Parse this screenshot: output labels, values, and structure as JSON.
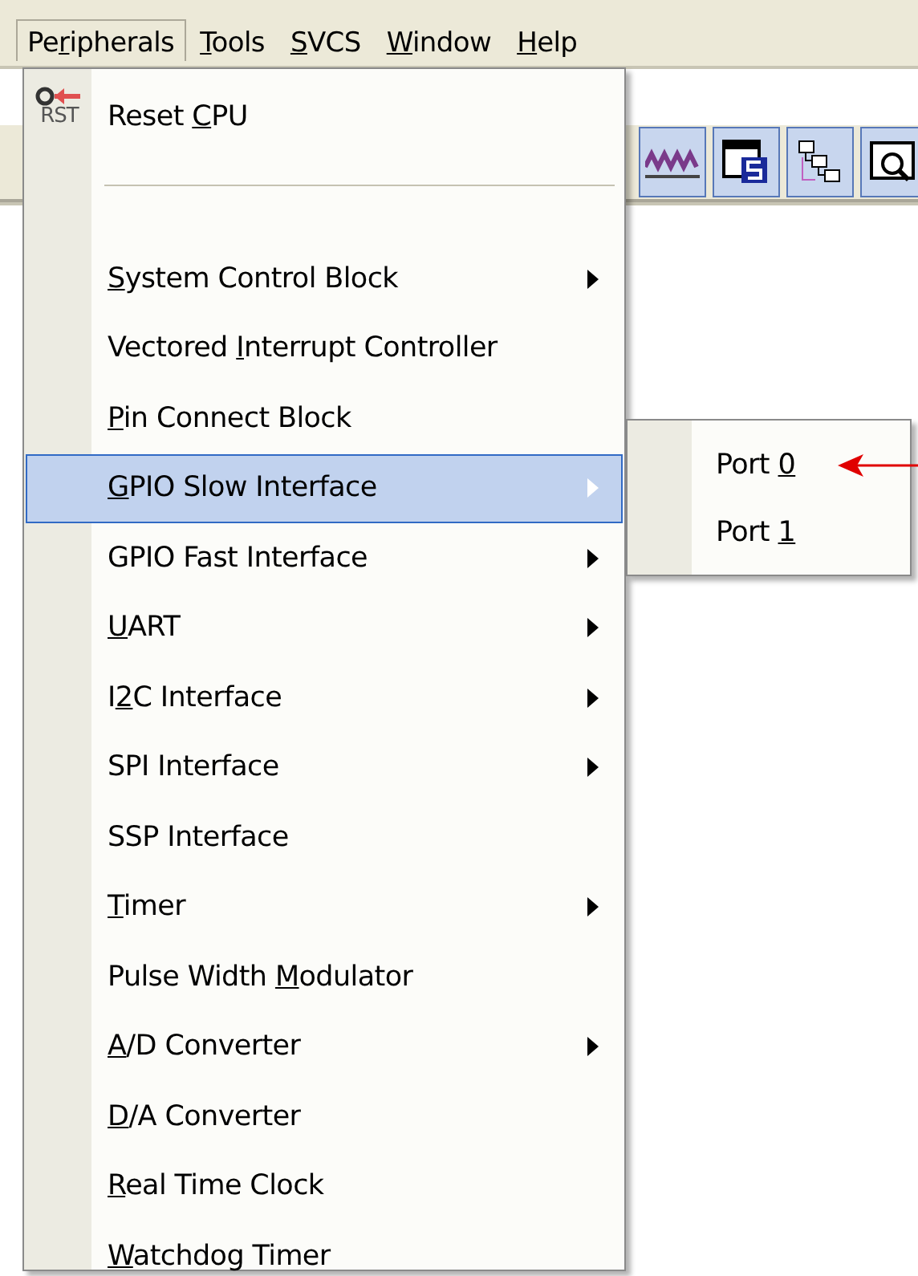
{
  "menubar": [
    {
      "label": {
        "before": "Pe",
        "key": "r",
        "after": "ipherals"
      },
      "selected": true
    },
    {
      "label": {
        "key": "T",
        "after": "ools"
      },
      "selected": false
    },
    {
      "label": {
        "key": "S",
        "after": "VCS"
      },
      "selected": false
    },
    {
      "label": {
        "key": "W",
        "after": "indow"
      },
      "selected": false
    },
    {
      "label": {
        "key": "H",
        "after": "elp"
      },
      "selected": false
    }
  ],
  "menu": {
    "items": [
      {
        "kind": "command",
        "label": {
          "before": "Reset ",
          "key": "C",
          "after": "PU"
        },
        "icon_text": "RST",
        "selected": false
      },
      {
        "kind": "separator"
      },
      {
        "kind": "submenu",
        "label": {
          "key": "S",
          "after": "ystem Control Block"
        },
        "selected": false
      },
      {
        "kind": "command",
        "label": {
          "before": "Vectored ",
          "key": "I",
          "after": "nterrupt Controller"
        },
        "selected": false
      },
      {
        "kind": "command",
        "label": {
          "key": "P",
          "after": "in Connect Block"
        },
        "selected": false
      },
      {
        "kind": "submenu",
        "label": {
          "key": "G",
          "after": "PIO Slow Interface"
        },
        "selected": true
      },
      {
        "kind": "submenu",
        "label": {
          "after": "GPIO Fast Interface"
        },
        "selected": false
      },
      {
        "kind": "submenu",
        "label": {
          "key": "U",
          "after": "ART"
        },
        "selected": false
      },
      {
        "kind": "submenu",
        "label": {
          "before": "I",
          "key": "2",
          "after": "C Interface"
        },
        "selected": false
      },
      {
        "kind": "submenu",
        "label": {
          "after": "SPI Interface"
        },
        "selected": false
      },
      {
        "kind": "command",
        "label": {
          "after": "SSP Interface"
        },
        "selected": false
      },
      {
        "kind": "submenu",
        "label": {
          "key": "T",
          "after": "imer"
        },
        "selected": false
      },
      {
        "kind": "command",
        "label": {
          "before": "Pulse Width ",
          "key": "M",
          "after": "odulator"
        },
        "selected": false
      },
      {
        "kind": "submenu",
        "label": {
          "key": "A",
          "after": "/D Converter"
        },
        "selected": false
      },
      {
        "kind": "command",
        "label": {
          "key": "D",
          "after": "/A Converter"
        },
        "selected": false
      },
      {
        "kind": "command",
        "label": {
          "key": "R",
          "after": "eal Time Clock"
        },
        "selected": false
      },
      {
        "kind": "command",
        "label": {
          "key": "W",
          "after": "atchdog Timer"
        },
        "selected": false
      }
    ]
  },
  "submenu": {
    "items": [
      {
        "label": {
          "before": "Port ",
          "key": "0"
        },
        "selected": false
      },
      {
        "label": {
          "before": "Port ",
          "key": "1"
        },
        "selected": false
      }
    ]
  }
}
